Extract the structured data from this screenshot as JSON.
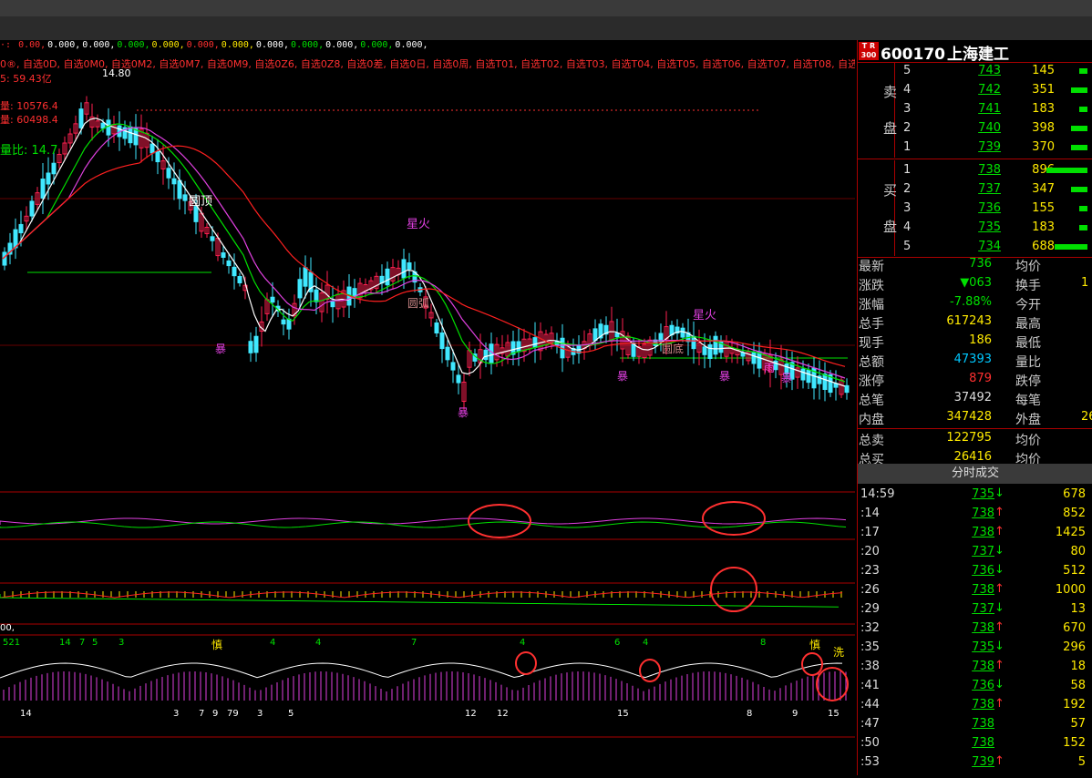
{
  "indicator_line": {
    "prefix": "·: ",
    "values": [
      "0.00,",
      "0.000,",
      "0.000,",
      "0.000,",
      "0.000,",
      "0.000,",
      "0.000,",
      "0.000,",
      "0.000,",
      "0.000,",
      "0.000,",
      "0.000,"
    ],
    "colors": [
      "#ff3030",
      "#ffffff",
      "#ffffff",
      "#00e000",
      "#ffea00",
      "#ff3030",
      "#ffea00",
      "#ffffff",
      "#00e000",
      "#ffffff",
      "#00e000",
      "#ffffff"
    ]
  },
  "selection_line": "0®, 自选0D, 自选0M0, 自选0M2, 自选0M7, 自选0M9, 自选0Z6, 自选0Z8, 自选0差, 自选0日, 自选0周, 自选T01, 自选T02, 自选T03, 自选T04, 自选T05, 自选T06, 自选T07, 自选T08, 自选T09, 自选",
  "left_labels": {
    "amount": "5: 59.43亿",
    "l1": "量: 10576.4",
    "l2": "量: 60498.4",
    "ratio": "量比: 14.7",
    "sub4": "00,"
  },
  "chart_annotations": {
    "high_price": "14.80",
    "round_top": "圆顶",
    "star_fire": "星火",
    "round_arc": "圆弧",
    "round_bottom": "圆底",
    "rain": "雨",
    "bao": "暴",
    "shen": "慎",
    "xi": "洗",
    "tops": "顶",
    "nums": [
      "521",
      "14",
      "7",
      "5",
      "3",
      "4",
      "4",
      "7",
      "4",
      "6",
      "4",
      "8"
    ],
    "bottom_nums": [
      "14",
      "3",
      "7",
      "9",
      "79",
      "3",
      "5",
      "12",
      "12",
      "15",
      "8",
      "9",
      "15"
    ]
  },
  "stock": {
    "code": "600170",
    "name": "上海建工",
    "badge_top": "T R",
    "badge_bottom": "300"
  },
  "order_book": {
    "sell_label_1": "卖",
    "sell_label_2": "盘",
    "buy_label_1": "买",
    "buy_label_2": "盘",
    "sell": [
      {
        "level": "5",
        "price": "743",
        "volume": "145",
        "bar": 0.02
      },
      {
        "level": "4",
        "price": "742",
        "volume": "351",
        "bar": 0.04
      },
      {
        "level": "3",
        "price": "741",
        "volume": "183",
        "bar": 0.02
      },
      {
        "level": "2",
        "price": "740",
        "volume": "398",
        "bar": 0.04
      },
      {
        "level": "1",
        "price": "739",
        "volume": "370",
        "bar": 0.04
      }
    ],
    "buy": [
      {
        "level": "1",
        "price": "738",
        "volume": "896",
        "bar": 0.1
      },
      {
        "level": "2",
        "price": "737",
        "volume": "347",
        "bar": 0.04
      },
      {
        "level": "3",
        "price": "736",
        "volume": "155",
        "bar": 0.02
      },
      {
        "level": "4",
        "price": "735",
        "volume": "183",
        "bar": 0.02
      },
      {
        "level": "5",
        "price": "734",
        "volume": "688",
        "bar": 0.08
      }
    ]
  },
  "stats": [
    {
      "label": "最新",
      "value": "736",
      "color": "#00e000",
      "label2": "均价",
      "value2": ""
    },
    {
      "label": "涨跌",
      "value": "▼063",
      "color": "#00e000",
      "label2": "换手",
      "value2": "1"
    },
    {
      "label": "涨幅",
      "value": "-7.88%",
      "color": "#00e000",
      "label2": "今开",
      "value2": ""
    },
    {
      "label": "总手",
      "value": "617243",
      "color": "#ffea00",
      "label2": "最高",
      "value2": ""
    },
    {
      "label": "现手",
      "value": "186",
      "color": "#ffea00",
      "label2": "最低",
      "value2": ""
    },
    {
      "label": "总额",
      "value": "47393",
      "color": "#00c8ff",
      "label2": "量比",
      "value2": ""
    },
    {
      "label": "涨停",
      "value": "879",
      "color": "#ff3030",
      "label2": "跌停",
      "value2": ""
    },
    {
      "label": "总笔",
      "value": "37492",
      "color": "#ddd",
      "label2": "每笔",
      "value2": ""
    },
    {
      "label": "内盘",
      "value": "347428",
      "color": "#ffea00",
      "label2": "外盘",
      "value2": "26"
    },
    {
      "label": "总卖",
      "value": "122795",
      "color": "#ffea00",
      "label2": "均价",
      "value2": ""
    },
    {
      "label": "总买",
      "value": "26416",
      "color": "#ffea00",
      "label2": "均价",
      "value2": ""
    }
  ],
  "ticks": {
    "header": "分时成交",
    "rows": [
      {
        "time": "14:59",
        "price": "735",
        "dir": "down",
        "volume": "678"
      },
      {
        "time": ":14",
        "price": "738",
        "dir": "up",
        "volume": "852"
      },
      {
        "time": ":17",
        "price": "738",
        "dir": "up",
        "volume": "1425"
      },
      {
        "time": ":20",
        "price": "737",
        "dir": "down",
        "volume": "80"
      },
      {
        "time": ":23",
        "price": "736",
        "dir": "down",
        "volume": "512"
      },
      {
        "time": ":26",
        "price": "738",
        "dir": "up",
        "volume": "1000"
      },
      {
        "time": ":29",
        "price": "737",
        "dir": "down",
        "volume": "13"
      },
      {
        "time": ":32",
        "price": "738",
        "dir": "up",
        "volume": "670"
      },
      {
        "time": ":35",
        "price": "735",
        "dir": "down",
        "volume": "296"
      },
      {
        "time": ":38",
        "price": "738",
        "dir": "up",
        "volume": "18"
      },
      {
        "time": ":41",
        "price": "736",
        "dir": "down",
        "volume": "58"
      },
      {
        "time": ":44",
        "price": "738",
        "dir": "up",
        "volume": "192"
      },
      {
        "time": ":47",
        "price": "738",
        "dir": "",
        "volume": "57"
      },
      {
        "time": ":50",
        "price": "738",
        "dir": "",
        "volume": "152"
      },
      {
        "time": ":53",
        "price": "739",
        "dir": "up",
        "volume": "5"
      }
    ]
  }
}
